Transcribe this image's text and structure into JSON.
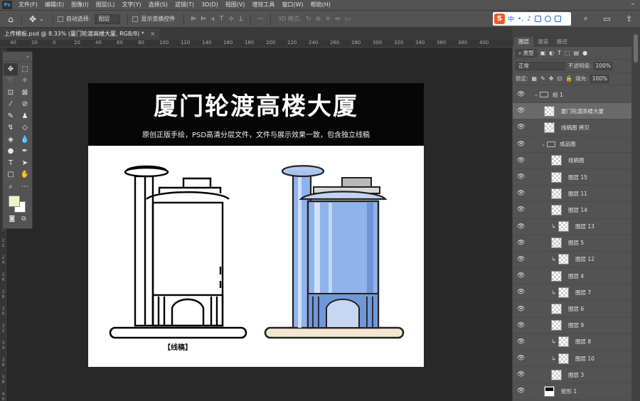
{
  "menubar": {
    "logo": "Ps",
    "items": [
      "文件(F)",
      "编辑(E)",
      "图像(I)",
      "图层(L)",
      "文字(Y)",
      "选择(S)",
      "滤镜(T)",
      "3D(D)",
      "视图(V)",
      "增效工具",
      "窗口(W)",
      "帮助(H)"
    ]
  },
  "options": {
    "auto_select_label": "自动选择:",
    "auto_select_value": "图层",
    "show_transform_label": "显示变换控件",
    "mode3d_label": "3D 模式:"
  },
  "ime": {
    "logo": "S",
    "lang": "中"
  },
  "document": {
    "tab_title": "上传模板.psd @ 8.33% (厦门轮渡高楼大厦, RGB/8) *",
    "close": "×"
  },
  "ruler": {
    "h_ticks": [
      "40",
      "20",
      "0",
      "20",
      "40",
      "60",
      "80",
      "100",
      "120",
      "140",
      "160",
      "180",
      "200",
      "220",
      "240",
      "260",
      "280",
      "300",
      "320",
      "340",
      "360",
      "380",
      "400"
    ],
    "v_ticks": [
      "0",
      "2",
      "4",
      "6",
      "8",
      "1 0",
      "1 2",
      "1 4",
      "1 6",
      "1 8",
      "2 0",
      "2 2",
      "2 4",
      "2 6",
      "2 8",
      "3 0",
      "3 2",
      "3 4",
      "3 6",
      "3 8",
      "4 0"
    ]
  },
  "canvas": {
    "title": "厦门轮渡高楼大厦",
    "subtitle": "原创正版手绘，PSD高清分层文件，文件与展示效果一致，包含独立线稿",
    "line_label": "【线稿】"
  },
  "panel": {
    "tabs": [
      "图层",
      "通道",
      "路径"
    ],
    "kind_filter": "类型",
    "blend_mode": "正常",
    "opacity_label": "不透明度:",
    "opacity_value": "100%",
    "lock_label": "锁定:",
    "fill_label": "填充:",
    "fill_value": "100%"
  },
  "layers": [
    {
      "name": "组 1",
      "kind": "group",
      "indent": 0
    },
    {
      "name": "厦门轮渡高楼大厦",
      "kind": "layer",
      "indent": 1,
      "selected": true
    },
    {
      "name": "线稿图 拷贝",
      "kind": "layer",
      "indent": 1
    },
    {
      "name": "成品图",
      "kind": "group",
      "indent": 1
    },
    {
      "name": "线稿图",
      "kind": "layer",
      "indent": 2
    },
    {
      "name": "图层 15",
      "kind": "layer",
      "indent": 2
    },
    {
      "name": "图层 11",
      "kind": "layer",
      "indent": 2
    },
    {
      "name": "图层 14",
      "kind": "layer",
      "indent": 2
    },
    {
      "name": "图层 13",
      "kind": "clip",
      "indent": 2
    },
    {
      "name": "图层 5",
      "kind": "layer",
      "indent": 2
    },
    {
      "name": "图层 12",
      "kind": "clip",
      "indent": 2
    },
    {
      "name": "图层 4",
      "kind": "layer",
      "indent": 2
    },
    {
      "name": "图层 7",
      "kind": "clip",
      "indent": 2
    },
    {
      "name": "图层 6",
      "kind": "layer",
      "indent": 2
    },
    {
      "name": "图层 9",
      "kind": "layer",
      "indent": 2
    },
    {
      "name": "图层 8",
      "kind": "clip",
      "indent": 2
    },
    {
      "name": "图层 10",
      "kind": "clip",
      "indent": 2
    },
    {
      "name": "图层 3",
      "kind": "layer",
      "indent": 2
    },
    {
      "name": "矩形 1",
      "kind": "shape",
      "indent": 1
    },
    {
      "name": "图层 9",
      "kind": "layer",
      "indent": 1
    }
  ],
  "colors": {
    "foreground": "#f0f2c8",
    "background": "#ffffff",
    "building_blue": "#8fb3ea",
    "building_dark_blue": "#5a82c7",
    "ground": "#f3e6d2"
  }
}
